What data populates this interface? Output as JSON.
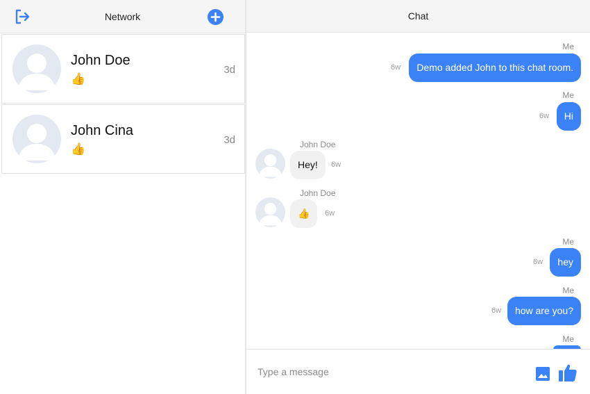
{
  "network": {
    "title": "Network",
    "icons": {
      "logout": "logout-icon",
      "add": "plus-icon"
    },
    "conversations": [
      {
        "name": "John Doe",
        "preview": "👍",
        "time": "3d"
      },
      {
        "name": "John Cina",
        "preview": "👍",
        "time": "3d"
      }
    ]
  },
  "chat": {
    "title": "Chat",
    "messages": [
      {
        "sender": "Me",
        "text": "Demo added John to this chat room.",
        "time": "6w"
      },
      {
        "sender": "Me",
        "text": "Hi",
        "time": "6w"
      },
      {
        "sender": "John Doe",
        "text": "Hey!",
        "time": "6w"
      },
      {
        "sender": "John Doe",
        "text": "👍",
        "time": "6w"
      },
      {
        "sender": "Me",
        "text": "hey",
        "time": "6w"
      },
      {
        "sender": "Me",
        "text": "how are you?",
        "time": "6w"
      },
      {
        "sender": "Me"
      }
    ],
    "composer": {
      "placeholder": "Type a message"
    },
    "icons": {
      "image": "image-icon",
      "like": "thumbs-up-icon"
    }
  },
  "colors": {
    "accent": "#3b82f6",
    "header_bg": "#f5f5f5",
    "avatar_bg": "#e4e8f0"
  }
}
